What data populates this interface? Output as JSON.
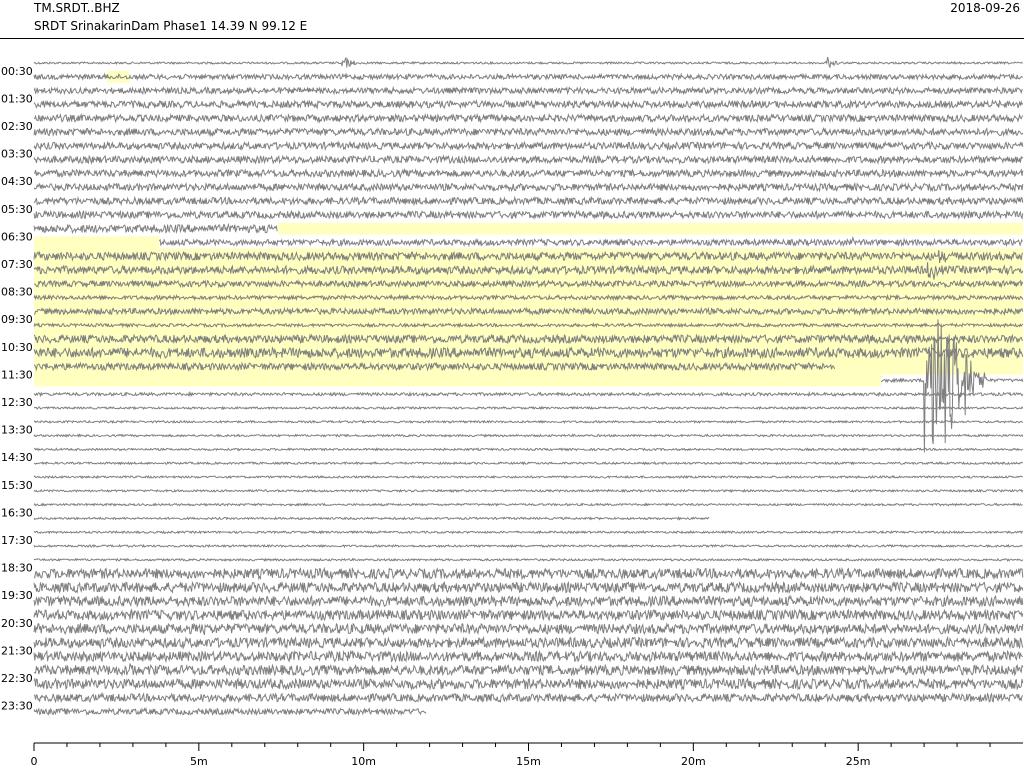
{
  "header": {
    "station_code": "TM.SRDT..BHZ",
    "station_desc": "SRDT SrinakarinDam Phase1  14.39 N 99.12 E",
    "date": "2018-09-26"
  },
  "colors": {
    "trace": "#808080",
    "gap": "#ffffc0",
    "axis": "#000000"
  },
  "chart_data": {
    "type": "helicorder",
    "xlim": [
      0,
      30
    ],
    "x_unit": "minutes",
    "xticks": [
      {
        "value": 0,
        "label": "0"
      },
      {
        "value": 5,
        "label": "5m"
      },
      {
        "value": 10,
        "label": "10m"
      },
      {
        "value": 15,
        "label": "15m"
      },
      {
        "value": 20,
        "label": "20m"
      },
      {
        "value": 25,
        "label": "25m"
      }
    ],
    "row_labels": [
      "00:30",
      "01:30",
      "02:30",
      "03:30",
      "04:30",
      "05:30",
      "06:30",
      "07:30",
      "08:30",
      "09:30",
      "10:30",
      "11:30",
      "12:30",
      "13:30",
      "14:30",
      "15:30",
      "16:30",
      "17:30",
      "18:30",
      "19:30",
      "20:30",
      "21:30",
      "22:30",
      "23:30"
    ],
    "rows_per_label": 2,
    "row_count": 48,
    "row_amplitude": [
      1.0,
      2.5,
      3.0,
      3.5,
      3.5,
      3.5,
      3.5,
      3.5,
      3.5,
      3.5,
      3.5,
      3.5,
      4.0,
      3.0,
      4.0,
      4.0,
      3.0,
      2.0,
      3.0,
      1.5,
      4.0,
      5.0,
      3.5,
      1.5,
      1.5,
      1.0,
      1.0,
      1.0,
      1.0,
      1.0,
      1.0,
      1.0,
      1.0,
      1.0,
      1.0,
      1.0,
      1.0,
      5.0,
      5.0,
      5.0,
      5.0,
      5.0,
      5.0,
      5.0,
      5.0,
      5.0,
      4.0,
      3.0
    ],
    "data_ranges": [
      {
        "row": 0,
        "from": 0,
        "to": 30
      },
      {
        "row": 1,
        "from": 0,
        "to": 30
      },
      {
        "row": 2,
        "from": 0,
        "to": 30
      },
      {
        "row": 3,
        "from": 0,
        "to": 30
      },
      {
        "row": 4,
        "from": 0,
        "to": 30
      },
      {
        "row": 5,
        "from": 0,
        "to": 30
      },
      {
        "row": 6,
        "from": 0,
        "to": 30
      },
      {
        "row": 7,
        "from": 0,
        "to": 30
      },
      {
        "row": 8,
        "from": 0,
        "to": 30
      },
      {
        "row": 9,
        "from": 0,
        "to": 30
      },
      {
        "row": 10,
        "from": 0,
        "to": 30
      },
      {
        "row": 11,
        "from": 0,
        "to": 30
      },
      {
        "row": 12,
        "from": 0,
        "to": 7.4
      },
      {
        "row": 13,
        "from": 3.8,
        "to": 30
      },
      {
        "row": 14,
        "from": 0,
        "to": 30
      },
      {
        "row": 15,
        "from": 0,
        "to": 30
      },
      {
        "row": 16,
        "from": 0,
        "to": 30
      },
      {
        "row": 17,
        "from": 0,
        "to": 30
      },
      {
        "row": 18,
        "from": 0,
        "to": 30
      },
      {
        "row": 19,
        "from": 0,
        "to": 30
      },
      {
        "row": 20,
        "from": 0,
        "to": 30
      },
      {
        "row": 21,
        "from": 0,
        "to": 30
      },
      {
        "row": 22,
        "from": 0,
        "to": 24.3
      },
      {
        "row": 23,
        "from": 25.7,
        "to": 30
      },
      {
        "row": 24,
        "from": 0,
        "to": 30
      },
      {
        "row": 25,
        "from": 0,
        "to": 30
      },
      {
        "row": 26,
        "from": 0,
        "to": 30
      },
      {
        "row": 27,
        "from": 0,
        "to": 30
      },
      {
        "row": 28,
        "from": 0,
        "to": 30
      },
      {
        "row": 29,
        "from": 0,
        "to": 30
      },
      {
        "row": 30,
        "from": 0,
        "to": 30
      },
      {
        "row": 31,
        "from": 0,
        "to": 30
      },
      {
        "row": 32,
        "from": 0,
        "to": 30
      },
      {
        "row": 33,
        "from": 0,
        "to": 20.5
      },
      {
        "row": 34,
        "from": 0,
        "to": 30
      },
      {
        "row": 35,
        "from": 0,
        "to": 30
      },
      {
        "row": 36,
        "from": 0,
        "to": 30
      },
      {
        "row": 37,
        "from": 0,
        "to": 30
      },
      {
        "row": 38,
        "from": 0,
        "to": 30
      },
      {
        "row": 39,
        "from": 0,
        "to": 30
      },
      {
        "row": 40,
        "from": 0,
        "to": 30
      },
      {
        "row": 41,
        "from": 0,
        "to": 30
      },
      {
        "row": 42,
        "from": 0,
        "to": 30
      },
      {
        "row": 43,
        "from": 0,
        "to": 30
      },
      {
        "row": 44,
        "from": 0,
        "to": 30
      },
      {
        "row": 45,
        "from": 0,
        "to": 30
      },
      {
        "row": 46,
        "from": 0,
        "to": 30
      },
      {
        "row": 47,
        "from": 0,
        "to": 11.9
      }
    ],
    "gaps": [
      {
        "row": 1,
        "from": 2.2,
        "to": 2.9
      },
      {
        "row": 12,
        "from": 7.4,
        "to": 30
      },
      {
        "row": 13,
        "from": 0,
        "to": 3.8
      },
      {
        "row": 22,
        "from": 24.3,
        "to": 30
      },
      {
        "row": 23,
        "from": 0,
        "to": 25.7
      }
    ],
    "events": [
      {
        "row": 0,
        "x": 9.4,
        "amplitude": 8,
        "duration": 0.5
      },
      {
        "row": 0,
        "x": 24.1,
        "amplitude": 9,
        "duration": 0.4
      },
      {
        "row": 13,
        "x": 24.9,
        "amplitude": 5,
        "duration": 0.3
      },
      {
        "row": 14,
        "x": 27.5,
        "amplitude": 8,
        "duration": 1.0
      },
      {
        "row": 15,
        "x": 27.2,
        "amplitude": 12,
        "duration": 0.6
      },
      {
        "row": 23,
        "x": 27.1,
        "amplitude": 100,
        "duration": 1.8
      },
      {
        "row": 41,
        "x": 5.2,
        "amplitude": 8,
        "duration": 0.2
      },
      {
        "row": 44,
        "x": 3.0,
        "amplitude": 9,
        "duration": 0.6
      }
    ]
  }
}
